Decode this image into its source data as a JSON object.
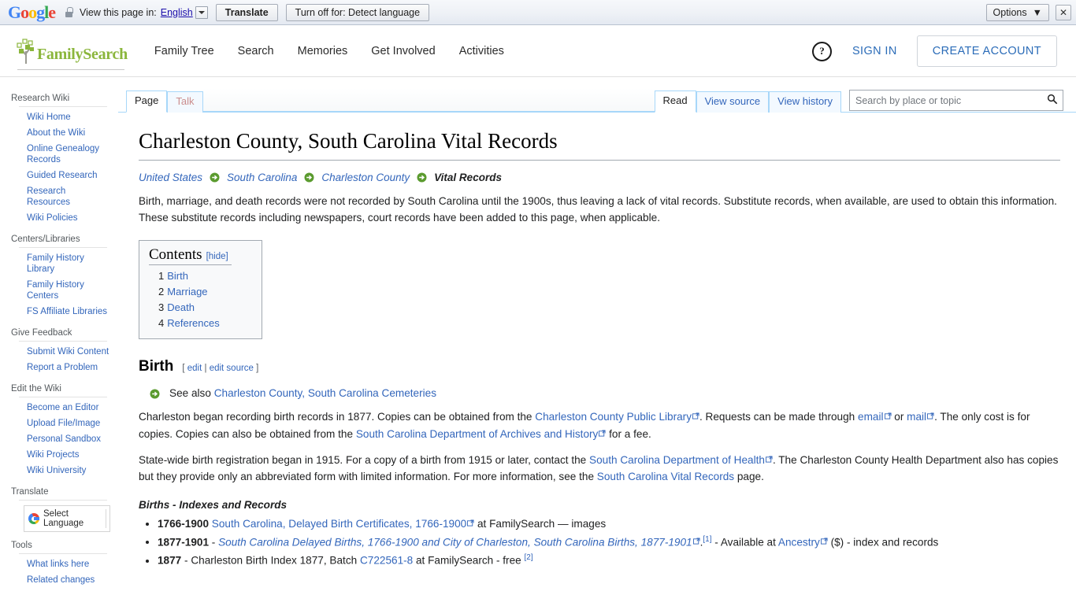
{
  "translate_bar": {
    "logo_letters": [
      "G",
      "o",
      "o",
      "g",
      "l",
      "e"
    ],
    "lock_icon": "lock-icon",
    "view_text": "View this page in:",
    "language": "English",
    "translate_button": "Translate",
    "turnoff_button": "Turn off for: Detect language",
    "options_button": "Options",
    "options_caret": "▼",
    "close_button": "✕"
  },
  "header": {
    "brand": "FamilySearch",
    "brand_color": "#8bb63c",
    "nav": [
      {
        "label": "Family Tree"
      },
      {
        "label": "Search"
      },
      {
        "label": "Memories"
      },
      {
        "label": "Get Involved"
      },
      {
        "label": "Activities"
      }
    ],
    "help_icon": "question-mark-circle-icon",
    "help_glyph": "?",
    "sign_in": "SIGN IN",
    "create_account": "CREATE ACCOUNT",
    "link_color": "#2b6cb8"
  },
  "sidebar": {
    "groups": [
      {
        "heading": "Research Wiki",
        "items": [
          "Wiki Home",
          "About the Wiki",
          "Online Genealogy Records",
          "Guided Research",
          "Research Resources",
          "Wiki Policies"
        ]
      },
      {
        "heading": "Centers/Libraries",
        "items": [
          "Family History Library",
          "Family History Centers",
          "FS Affiliate Libraries"
        ]
      },
      {
        "heading": "Give Feedback",
        "items": [
          "Submit Wiki Content",
          "Report a Problem"
        ]
      },
      {
        "heading": "Edit the Wiki",
        "items": [
          "Become an Editor",
          "Upload File/Image",
          "Personal Sandbox",
          "Wiki Projects",
          "Wiki University"
        ]
      }
    ],
    "translate_heading": "Translate",
    "select_language": "Select Language",
    "google_icon": "google-g-icon",
    "tools_heading": "Tools",
    "tools_items": [
      "What links here",
      "Related changes"
    ]
  },
  "tabs": {
    "left": [
      {
        "label": "Page",
        "state": "selected"
      },
      {
        "label": "Talk",
        "state": "newpage"
      }
    ],
    "right": [
      {
        "label": "Read",
        "state": "selected"
      },
      {
        "label": "View source",
        "state": "normal"
      },
      {
        "label": "View history",
        "state": "normal"
      }
    ]
  },
  "search": {
    "placeholder": "Search by place or topic",
    "value": "",
    "icon": "search-icon"
  },
  "main": {
    "title": "Charleston County, South Carolina Vital Records",
    "breadcrumb": [
      "United States",
      "South Carolina",
      "Charleston County",
      "Vital Records"
    ],
    "intro": "Birth, marriage, and death records were not recorded by South Carolina until the 1900s, thus leaving a lack of vital records. Substitute records, when available, are used to obtain this information. These substitute records including newspapers, court records have been added to this page, when applicable.",
    "toc": {
      "title": "Contents",
      "toggle": "[hide]",
      "items": [
        {
          "num": "1",
          "label": "Birth"
        },
        {
          "num": "2",
          "label": "Marriage"
        },
        {
          "num": "3",
          "label": "Death"
        },
        {
          "num": "4",
          "label": "References"
        }
      ]
    },
    "birth": {
      "heading": "Birth",
      "edit_open": "[",
      "edit": "edit",
      "edit_sep": "|",
      "edit_source": "edit source",
      "edit_close": "]",
      "see_also_prefix": "See also",
      "see_also_link": "Charleston County, South Carolina Cemeteries",
      "para1_a": "Charleston began recording birth records in 1877. Copies can be obtained from the ",
      "para1_link1": "Charleston County Public Library",
      "para1_b": ". Requests can be made through ",
      "para1_link2": "email",
      "para1_c": " or ",
      "para1_link3": "mail",
      "para1_d": ". The only cost is for copies. Copies can also be obtained from the ",
      "para1_link4": "South Carolina Department of Archives and History",
      "para1_e": " for a fee.",
      "para2_a": "State-wide birth registration began in 1915. For a copy of a birth from 1915 or later, contact the ",
      "para2_link1": "South Carolina Department of Health",
      "para2_b": ". The Charleston County Health Department also has copies but they provide only an abbreviated form with limited information. For more information, see the ",
      "para2_link2": "South Carolina Vital Records",
      "para2_c": " page.",
      "subsection": "Births - Indexes and Records",
      "records": [
        {
          "years": "1766-1900",
          "dash": "",
          "link": "South Carolina, Delayed Birth Certificates, 1766-1900",
          "link_italic": false,
          "external": true,
          "ref": "",
          "tail": " at FamilySearch — images"
        },
        {
          "years": "1877-1901",
          "dash": " - ",
          "link": "South Carolina Delayed Births, 1766-1900 and City of Charleston, South Carolina Births, 1877-1901",
          "link_italic": true,
          "external": true,
          "ref": "[1]",
          "tail_pre": ".",
          "tail": " - Available at ",
          "tail_link": "Ancestry",
          "tail_after": " ($) - index and records"
        },
        {
          "years": "1877",
          "dash": " - ",
          "plain": "Charleston Birth Index 1877, Batch ",
          "link": "C722561-8",
          "link_italic": false,
          "external": false,
          "ref": "[2]",
          "tail": " at FamilySearch - free "
        }
      ]
    }
  }
}
